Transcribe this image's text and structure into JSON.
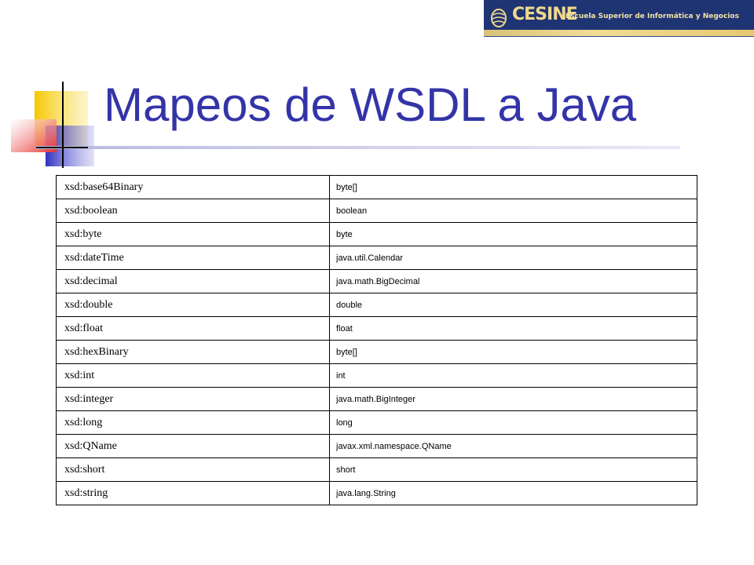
{
  "logo": {
    "mark": "CESINE",
    "tagline": "Escuela Superior de Informática y Negocios"
  },
  "slide": {
    "title": "Mapeos de WSDL a Java"
  },
  "mappings": [
    {
      "xsd": "xsd:base64Binary",
      "java": "byte[]"
    },
    {
      "xsd": "xsd:boolean",
      "java": "boolean"
    },
    {
      "xsd": "xsd:byte",
      "java": "byte"
    },
    {
      "xsd": "xsd:dateTime",
      "java": "java.util.Calendar"
    },
    {
      "xsd": "xsd:decimal",
      "java": "java.math.BigDecimal"
    },
    {
      "xsd": "xsd:double",
      "java": "double"
    },
    {
      "xsd": "xsd:float",
      "java": "float"
    },
    {
      "xsd": "xsd:hexBinary",
      "java": "byte[]"
    },
    {
      "xsd": "xsd:int",
      "java": "int"
    },
    {
      "xsd": "xsd:integer",
      "java": "java.math.BigInteger"
    },
    {
      "xsd": "xsd:long",
      "java": "long"
    },
    {
      "xsd": "xsd:QName",
      "java": "javax.xml.namespace.QName"
    },
    {
      "xsd": "xsd:short",
      "java": "short"
    },
    {
      "xsd": "xsd:string",
      "java": "java.lang.String"
    }
  ],
  "colors": {
    "title": "#3434a8",
    "accent_yellow": "#f5c800",
    "accent_blue": "#3a3ac8",
    "accent_red": "#e83030",
    "logo_background": "#1f3473"
  }
}
